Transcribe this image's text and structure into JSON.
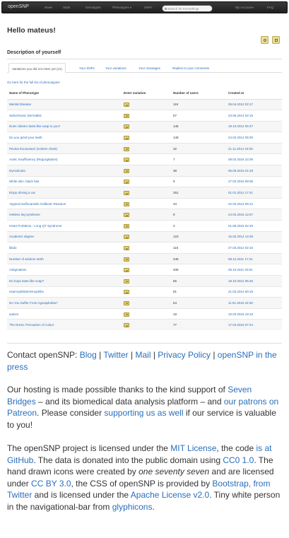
{
  "navbar": {
    "brand": "openSNP",
    "links": [
      "News",
      "Stats",
      "Genotypes",
      "Phenotypes",
      "SNPs",
      "My Account",
      "FAQ"
    ],
    "search_placeholder": "Search for Everything!"
  },
  "greeting": "Hello mateus!",
  "description_heading": "Description of yourself",
  "tabs": [
    "Variations you did not enter yet (21)",
    "Your SNPs",
    "Your variations",
    "Your messages",
    "Replies to your comments"
  ],
  "full_list_link": "Go here for the full list of phenotypes!",
  "table": {
    "headers": [
      "Name of Phenotype",
      "Enter variation",
      "Number of users",
      "Created at"
    ],
    "rows": [
      [
        "Mental Disease",
        "116",
        "05.04.2012 02:17"
      ],
      [
        "Seborrhoeic Dermatitis",
        "57",
        "23.05.2014 02:19"
      ],
      [
        "Does cilantro taste like soap to you?",
        "145",
        "19.10.2012 05:47"
      ],
      [
        "Do you grind your teeth",
        "149",
        "24.02.2014 05:00"
      ],
      [
        "Pectus Excavatum (sunken chest)",
        "32",
        "21.11.2014 19:25"
      ],
      [
        "Aortic Insufficiency (Regurgitation)",
        "7",
        "08.02.2016 22:09"
      ],
      [
        "Dyscalculia",
        "38",
        "06.05.2015 21:28"
      ],
      [
        "White skin, black hair",
        "9",
        "27.02.2016 09:08"
      ],
      [
        "Enjoy driving a car",
        "251",
        "01.01.2012 17:41"
      ],
      [
        "Atypical Sulfonamide Antibiotic Reaction",
        "43",
        "22.02.2013 09:12"
      ],
      [
        "restless leg syndrome",
        "9",
        "24.02.2016 12:57"
      ],
      [
        "Heart Problems - Long QT Syndrome",
        "3",
        "01.06.2016 02:49"
      ],
      [
        "Academic degree",
        "123",
        "15.02.2014 14:39"
      ],
      [
        "libido",
        "115",
        "27.03.2012 02:15"
      ],
      [
        "Number of wisdom teeth",
        "249",
        "08.12.2011 17:41"
      ],
      [
        "Astigmatism",
        "408",
        "05.10.2011 03:51"
      ],
      [
        "Do hops taste like soap?",
        "55",
        "19.10.2012 05:46"
      ],
      [
        "Haemophilia/Hemophilia",
        "81",
        "21.03.2014 00:18"
      ],
      [
        "Do You Suffer From Agoraphobia?",
        "54",
        "11.01.2015 22:28"
      ],
      [
        "autism",
        "18",
        "10.03.2015 19:10"
      ],
      [
        "The Dress: Perception of colour",
        "77",
        "17.03.2015 07:44"
      ]
    ]
  },
  "footer": {
    "contact_prefix": "Contact openSNP: ",
    "contact_links": [
      "Blog",
      "Twitter",
      "Mail",
      "Privacy Policy",
      "openSNP in the press"
    ],
    "sep": " | ",
    "hosting": {
      "t1": "Our hosting is made possible thanks to the kind support of ",
      "l1": "Seven Bridges",
      "t2": " – and its biomedical data analysis platform – and ",
      "l2": "our patrons on Patreon",
      "t3": ". Please consider ",
      "l3": "supporting us as well",
      "t4": " if our service is valuable to you!"
    },
    "license": {
      "t1": "The openSNP project is licensed under the ",
      "l1": "MIT License",
      "t2": ", the code ",
      "l2": "is at GitHub",
      "t3": ". The data is donated into the public domain using ",
      "l3": "CC0 1.0",
      "t4": ". The hand drawn icons were created by ",
      "em": "one seventy seven",
      "t5": " and are licensed under ",
      "l4": "CC BY 3.0",
      "t6": ", the CSS of openSNP is provided by ",
      "l5": "Bootstrap, from Twitter",
      "t7": " and is licensed under the ",
      "l6": "Apache License v2.0",
      "t8": ". Tiny white person in the navigational-bar from ",
      "l7": "glyphicons",
      "t9": "."
    }
  }
}
